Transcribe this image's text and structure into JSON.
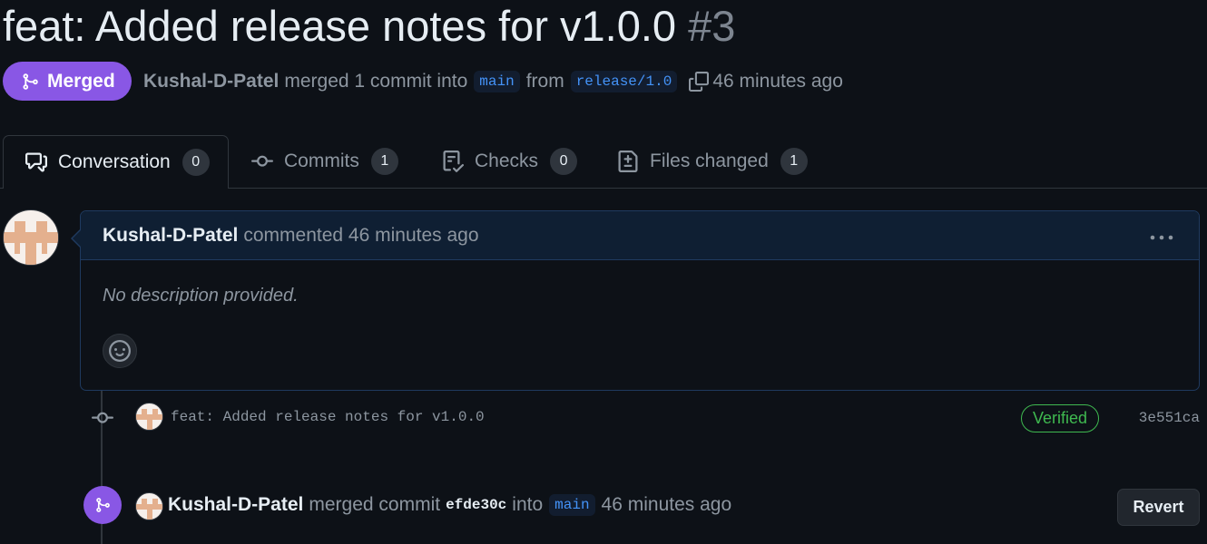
{
  "pr": {
    "title": "feat: Added release notes for v1.0.0",
    "number": "#3",
    "state": "Merged",
    "author": "Kushal-D-Patel",
    "summary_merged": "merged 1 commit into",
    "base_branch": "main",
    "from_word": "from",
    "head_branch": "release/1.0",
    "time": "46 minutes ago"
  },
  "tabs": [
    {
      "label": "Conversation",
      "count": "0",
      "icon": "comment-discussion-icon"
    },
    {
      "label": "Commits",
      "count": "1",
      "icon": "git-commit-icon"
    },
    {
      "label": "Checks",
      "count": "0",
      "icon": "checklist-icon"
    },
    {
      "label": "Files changed",
      "count": "1",
      "icon": "file-diff-icon"
    }
  ],
  "comment": {
    "author": "Kushal-D-Patel",
    "action": "commented 46 minutes ago",
    "body": "No description provided."
  },
  "commit": {
    "message": "feat: Added release notes for v1.0.0",
    "verified": "Verified",
    "sha": "3e551ca"
  },
  "merge_event": {
    "author": "Kushal-D-Patel",
    "action": "merged commit",
    "sha": "efde30c",
    "into": "into",
    "branch": "main",
    "time": "46 minutes ago",
    "revert_label": "Revert"
  },
  "colors": {
    "background": "#0d1117",
    "merged": "#8957e5",
    "verified": "#3fb950",
    "branch_text": "#4493f8"
  }
}
